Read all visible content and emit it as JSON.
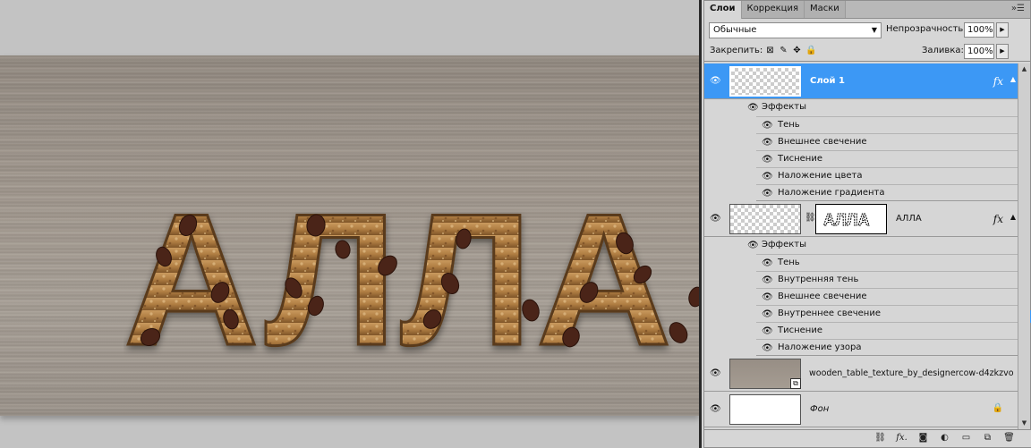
{
  "canvas": {
    "text": "АЛЛА"
  },
  "panel": {
    "tabs": [
      {
        "label": "Слои",
        "active": true
      },
      {
        "label": "Коррекция",
        "active": false
      },
      {
        "label": "Маски",
        "active": false
      }
    ],
    "menu_icon": "panel-menu-icon",
    "blend_mode": "Обычные",
    "opacity_label": "Непрозрачность:",
    "opacity_value": "100%",
    "lock_label": "Закрепить:",
    "fill_label": "Заливка:",
    "fill_value": "100%"
  },
  "layers": [
    {
      "name": "Слой 1",
      "selected": true,
      "has_fx": true,
      "effects_label": "Эффекты",
      "effects": [
        "Тень",
        "Внешнее свечение",
        "Тиснение",
        "Наложение цвета",
        "Наложение градиента"
      ]
    },
    {
      "name": "АЛЛА",
      "selected": false,
      "has_fx": true,
      "effects_label": "Эффекты",
      "effects": [
        "Тень",
        "Внутренняя тень",
        "Внешнее свечение",
        "Внутреннее свечение",
        "Тиснение",
        "Наложение узора"
      ]
    },
    {
      "name": "wooden_table_texture_by_designercow-d4zkzvo",
      "selected": false,
      "has_fx": false
    },
    {
      "name": "Фон",
      "selected": false,
      "has_fx": false,
      "locked": true
    }
  ],
  "colors": {
    "selection": "#3c98f5",
    "panel_bg": "#d6d6d6"
  }
}
